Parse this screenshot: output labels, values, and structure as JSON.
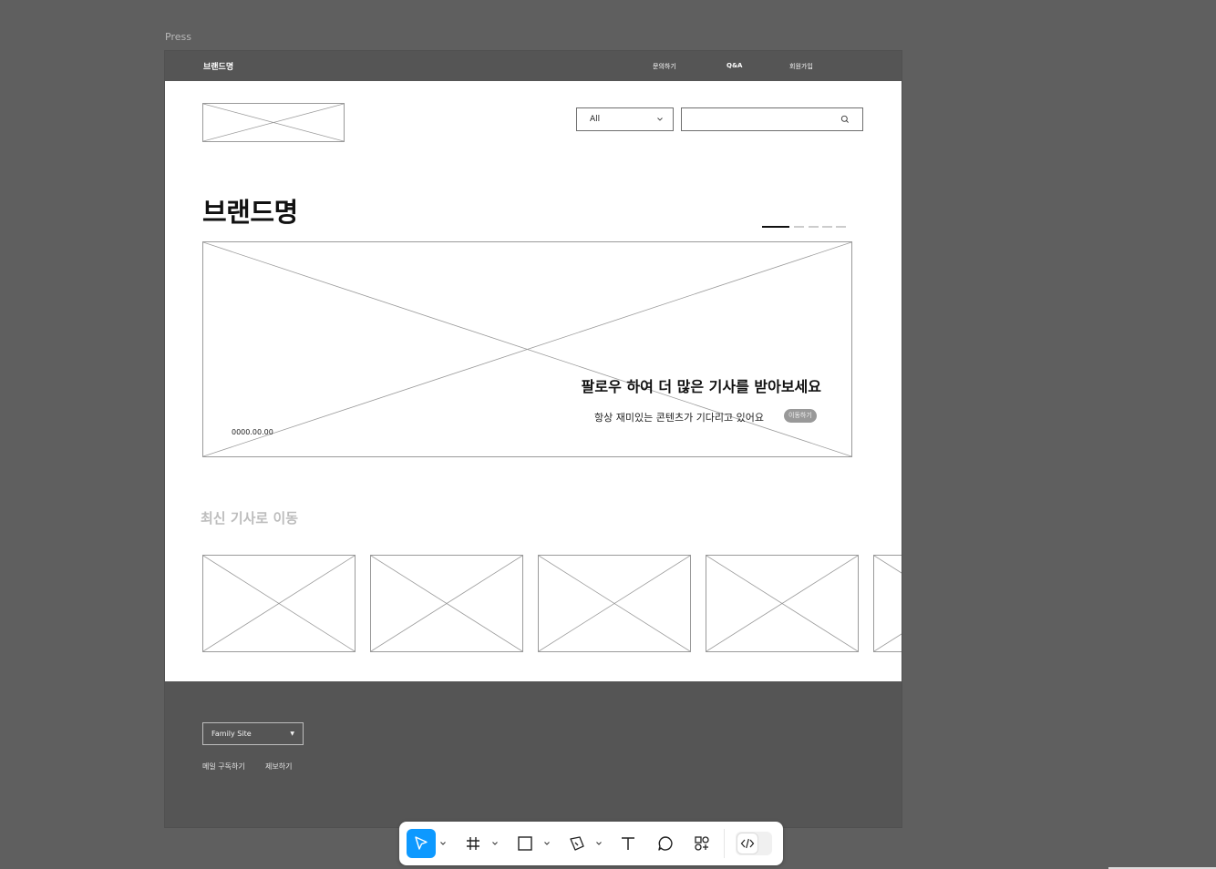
{
  "frame": {
    "label": "Press"
  },
  "topbar": {
    "brand": "브랜드명",
    "nav": [
      "문의하기",
      "Q&A",
      "회원가입"
    ]
  },
  "header": {
    "category_select": "All",
    "search_value": ""
  },
  "hero": {
    "title": "브랜드명",
    "slide": {
      "current": 1,
      "total": 5
    },
    "headline": "팔로우 하여 더 많은 기사를 받아보세요",
    "subtext": "항상 재미있는 콘텐츠가 기다리고 있어요",
    "move_button": "이동하기",
    "date": "0000.00.00"
  },
  "latest": {
    "title": "최신 기사로 이동",
    "card_count": 5
  },
  "footer": {
    "family_site": "Family Site",
    "links": [
      "메일 구독하기",
      "제보하기"
    ]
  },
  "toolbar": {
    "tools": [
      "move-tool",
      "frame-tool",
      "shape-tool",
      "pen-tool",
      "text-tool",
      "comment-tool",
      "actions-tool"
    ],
    "active": "move-tool",
    "dev_mode": false
  },
  "colors": {
    "canvas": "#5f5f5f",
    "bar": "#555555",
    "accent": "#0d99ff",
    "muted": "#bdbdbd"
  }
}
